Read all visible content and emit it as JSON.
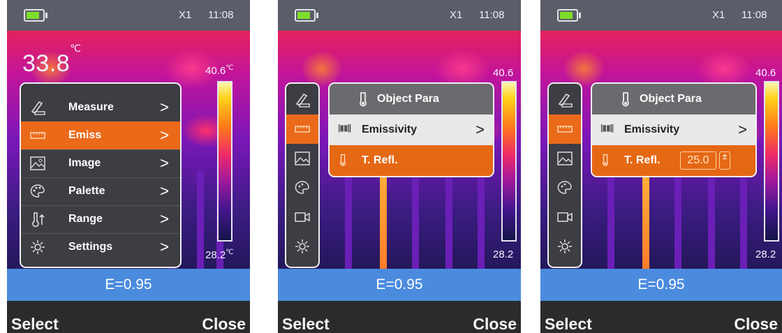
{
  "screens": [
    {
      "status": {
        "zoom": "X1",
        "time": "11:08"
      },
      "measurement": {
        "value": "33.8",
        "unit": "℃"
      },
      "scale": {
        "max": "40.6",
        "max_unit": "℃",
        "min": "28.2",
        "min_unit": "℃"
      },
      "menu": {
        "items": [
          {
            "label": "Measure",
            "icon": "measure-icon"
          },
          {
            "label": "Emiss",
            "icon": "emissivity-icon"
          },
          {
            "label": "Image",
            "icon": "image-icon"
          },
          {
            "label": "Palette",
            "icon": "palette-icon"
          },
          {
            "label": "Range",
            "icon": "range-thermometer-icon"
          },
          {
            "label": "Settings",
            "icon": "settings-gear-icon"
          }
        ],
        "active": "Emiss"
      },
      "emissivity": "E=0.95",
      "softkeys": {
        "left": "Select",
        "right": "Close"
      }
    },
    {
      "status": {
        "zoom": "X1",
        "time": "11:08"
      },
      "scale": {
        "max": "40.6",
        "min": "28.2"
      },
      "submenu": {
        "title": "Object Para",
        "rows": [
          {
            "label": "Emissivity",
            "icon": "emissivity-icon"
          },
          {
            "label": "T. Refl.",
            "icon": "thermometer-icon"
          }
        ],
        "selected": "T. Refl."
      },
      "emissivity": "E=0.95",
      "softkeys": {
        "left": "Select",
        "right": "Close"
      }
    },
    {
      "status": {
        "zoom": "X1",
        "time": "11:08"
      },
      "scale": {
        "max": "40.6",
        "min": "28.2"
      },
      "submenu": {
        "title": "Object Para",
        "rows": [
          {
            "label": "Emissivity",
            "icon": "emissivity-icon"
          },
          {
            "label": "T. Refl.",
            "icon": "thermometer-icon",
            "value": "25.0",
            "stepper": "±"
          }
        ],
        "selected": "T. Refl."
      },
      "emissivity": "E=0.95",
      "softkeys": {
        "left": "Select",
        "right": "Close"
      }
    }
  ],
  "colors": {
    "accent": "#ea6a1a",
    "status_bar": "#5b5d68",
    "emissivity_bar": "#4b8bde",
    "softkey_bar": "#2b2b2b",
    "menu_bg": "#3d3d44"
  }
}
